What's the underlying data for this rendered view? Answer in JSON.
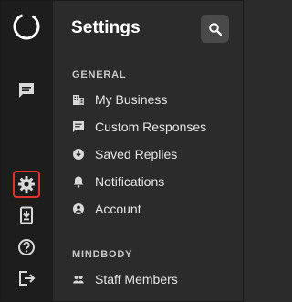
{
  "panel": {
    "title": "Settings"
  },
  "sections": [
    {
      "header": "GENERAL",
      "items": [
        {
          "label": "My Business",
          "icon": "business-icon"
        },
        {
          "label": "Custom Responses",
          "icon": "chat-bubble-icon"
        },
        {
          "label": "Saved Replies",
          "icon": "saved-replies-icon"
        },
        {
          "label": "Notifications",
          "icon": "bell-icon"
        },
        {
          "label": "Account",
          "icon": "account-icon"
        }
      ]
    },
    {
      "header": "MINDBODY",
      "items": [
        {
          "label": "Staff Members",
          "icon": "people-icon"
        }
      ]
    }
  ],
  "rail": {
    "icons": [
      "logo-icon",
      "messages-icon",
      "settings-icon",
      "download-app-icon",
      "help-icon",
      "logout-icon"
    ],
    "selected": "settings-icon"
  },
  "colors": {
    "rail_background": "#1d1d1d",
    "panel_background": "#2b2b2b",
    "selection_outline": "#e0332d",
    "search_button_background": "#4a4a4a"
  }
}
